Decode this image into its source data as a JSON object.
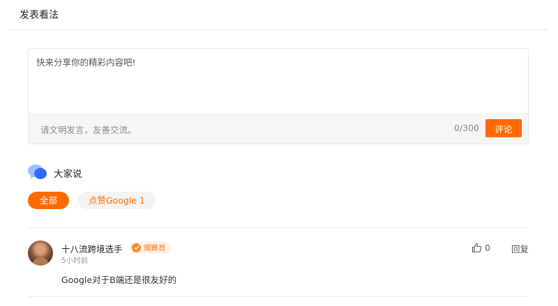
{
  "header": {
    "title": "发表看法"
  },
  "editor": {
    "placeholder": "快来分享你的精彩内容吧!",
    "value": "",
    "hint": "请文明发言，友善交流。",
    "char_count": "0/300",
    "submit_label": "评论"
  },
  "discussion": {
    "label": "大家说",
    "icon": "chat-bubbles-icon",
    "filters": [
      {
        "label": "全部",
        "active": true
      },
      {
        "label": "点赞Google 1",
        "active": false
      }
    ]
  },
  "comments": [
    {
      "username": "十八流跨境选手",
      "badge": "观察员",
      "time": "5小时前",
      "text": "Google对于B端还是很友好的",
      "likes": "0",
      "reply_label": "回复"
    }
  ],
  "colors": {
    "accent": "#ff6a00",
    "badge_bg": "#fff1e6",
    "icon_blue": "#2f6bff"
  }
}
